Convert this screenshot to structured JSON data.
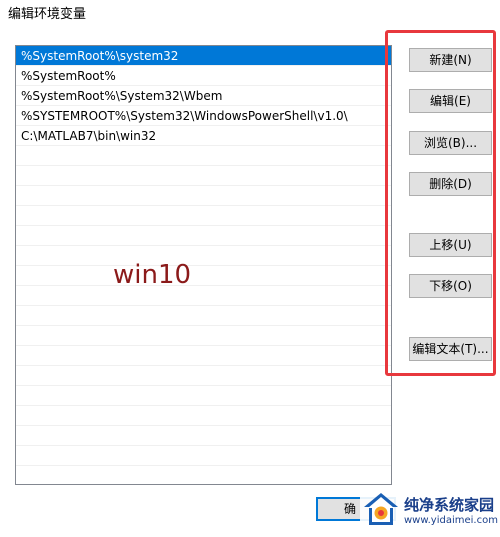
{
  "window": {
    "title": "编辑环境变量"
  },
  "path_list": {
    "items": [
      "%SystemRoot%\\system32",
      "%SystemRoot%",
      "%SystemRoot%\\System32\\Wbem",
      "%SYSTEMROOT%\\System32\\WindowsPowerShell\\v1.0\\",
      "C:\\MATLAB7\\bin\\win32"
    ],
    "selected_index": 0
  },
  "buttons": {
    "new": "新建(N)",
    "edit": "编辑(E)",
    "browse": "浏览(B)...",
    "delete": "删除(D)",
    "move_up": "上移(U)",
    "move_down": "下移(O)",
    "edit_text": "编辑文本(T)..."
  },
  "footer": {
    "ok": "确"
  },
  "overlay": {
    "label": "win10",
    "highlight_color": "#e8383d"
  },
  "watermark": {
    "site_name": "纯净系统家园",
    "site_url": "www.yidaimei.com"
  }
}
